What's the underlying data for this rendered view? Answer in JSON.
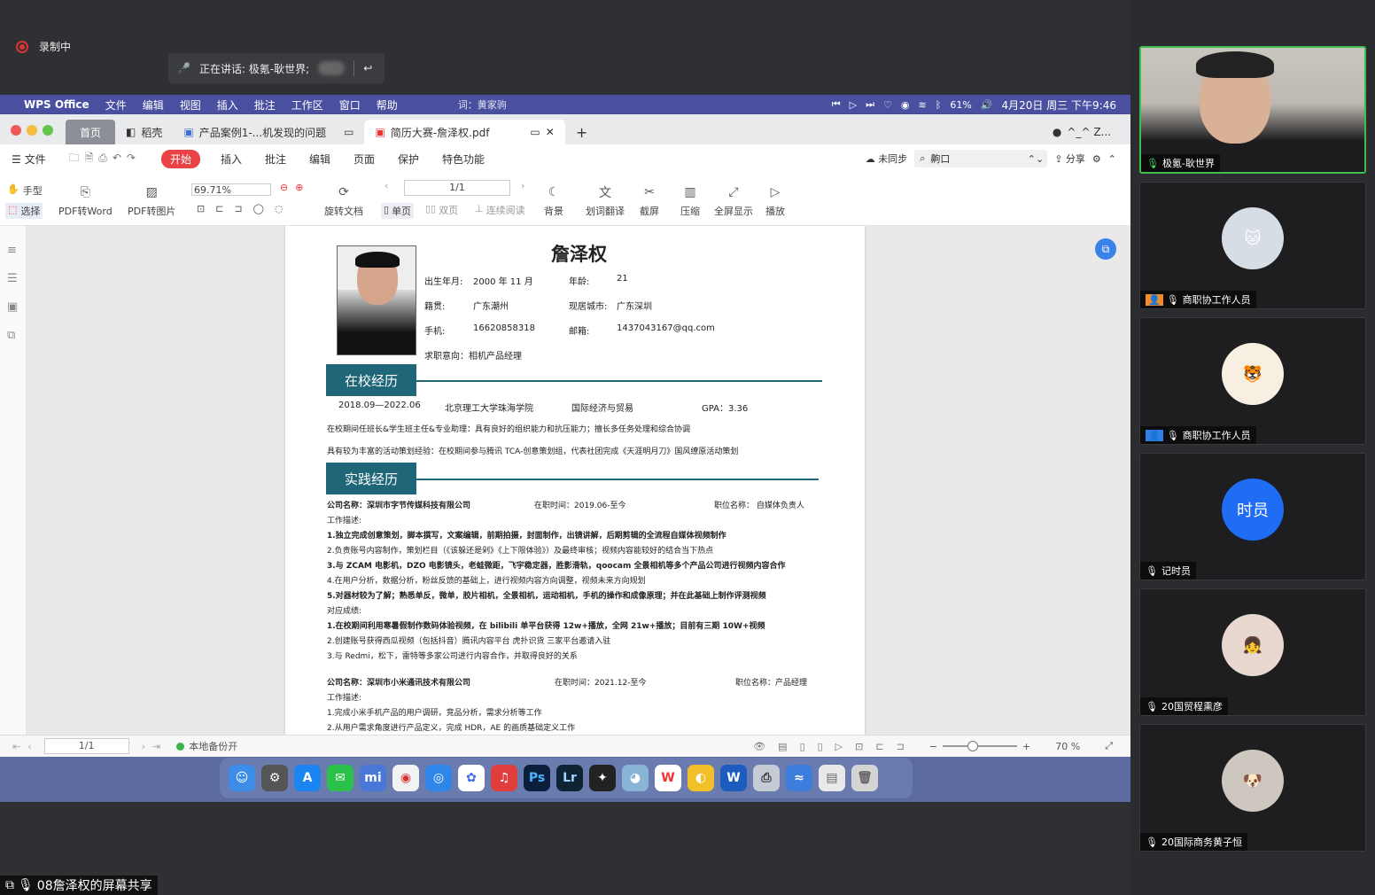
{
  "recording": {
    "label": "录制中"
  },
  "speaking": {
    "label": "正在讲话: 极氪-耿世界;"
  },
  "menubar": {
    "items": [
      "WPS Office",
      "文件",
      "编辑",
      "视图",
      "插入",
      "批注",
      "工作区",
      "窗口",
      "帮助"
    ],
    "input_hint": "词：黄家驹",
    "battery": "61%",
    "datetime": "4月20日 周三 下午9:46"
  },
  "tabs": {
    "home": "首页",
    "t1": "稻壳",
    "t2": "产品案例1-...机发现的问题",
    "t3": "简历大赛-詹泽权.pdf",
    "user": "^_^ Z..."
  },
  "menu2": {
    "file": "文件",
    "start": "开始",
    "items": [
      "插入",
      "批注",
      "编辑",
      "页面",
      "保护",
      "特色功能"
    ],
    "sync": "未同步",
    "search": "齁口",
    "share": "分享"
  },
  "toolbar": {
    "hand": "手型",
    "select": "选择",
    "pdf2word": "PDF转Word",
    "pdf2img": "PDF转图片",
    "zoom": "69.71%",
    "rotate": "旋转文档",
    "single": "单页",
    "double": "双页",
    "continuous": "连续阅读",
    "page": "1/1",
    "bg": "背景",
    "translate": "划词翻译",
    "screenshot": "截屏",
    "compress": "压缩",
    "fullscreen": "全屏显示",
    "play": "播放"
  },
  "resume": {
    "name": "詹泽权",
    "birth_label": "出生年月:",
    "birth": "2000 年 11 月",
    "age_label": "年龄:",
    "age": "21",
    "origin_label": "籍贯:",
    "origin": "广东潮州",
    "city_label": "现居城市:",
    "city": "广东深圳",
    "phone_label": "手机:",
    "phone": "16620858318",
    "email_label": "邮箱:",
    "email": "1437043167@qq.com",
    "intent": "求职意向：相机产品经理",
    "sec1": "在校经历",
    "edu_date": "2018.09—2022.06",
    "edu_school": "北京理工大学珠海学院",
    "edu_major": "国际经济与贸易",
    "edu_gpa": "GPA：3.36",
    "edu_l1": "在校期间任班长&学生班主任&专业助理：具有良好的组织能力和抗压能力；擅长多任务处理和综合协调",
    "edu_l2": "具有较为丰富的活动策划经验：在校期间参与腾讯 TCA-创意策划组，代表社团完成《天涯明月刀》国风缭原活动策划",
    "sec2": "实践经历",
    "c1_name": "公司名称：深圳市字节传媒科技有限公司",
    "c1_time": "在职时间：2019.06-至今",
    "c1_title": "职位名称：  自媒体负责人",
    "desc_label": "工作描述:",
    "c1_l1": "1.独立完成创意策划，脚本撰写，文案编辑，前期拍摄，封面制作，出镜讲解，后期剪辑的全流程自媒体视频制作",
    "c1_l2": "2.负责账号内容制作，策划栏目（《该躲还是剁》《上下限体验》）及最终审核；视频内容能较好的结合当下热点",
    "c1_l3": "3.与 ZCAM 电影机，DZO 电影镜头，老蛙微距，飞宇稳定器，胜影滑轨，qoocam 全景相机等多个产品公司进行视频内容合作",
    "c1_l4": "4.在用户分析，数据分析，粉丝反馈的基础上，进行视频内容方向调整，视频未来方向规划",
    "c1_l5": "5.对器材较为了解；熟悉单反，微单，胶片相机，全景相机，运动相机，手机的操作和成像原理；并在此基础上制作评测视频",
    "result_label": "对应成绩:",
    "c1_r1": "1.在校期间利用寒暑假制作数码体验视频，在 bilibili 单平台获得 12w+播放，全网 21w+播放；目前有三期 10W+视频",
    "c1_r2": "2.创建账号获得西瓜视频（包括抖音）腾讯内容平台 虎扑识货 三家平台邀请入驻",
    "c1_r3": "3.与 Redmi，松下，雷特等多家公司进行内容合作，并取得良好的关系",
    "c2_name": "公司名称：深圳市小米通讯技术有限公司",
    "c2_time": "在职时间：2021.12-至今",
    "c2_title": "职位名称：产品经理",
    "c2_l1": "1.完成小米手机产品的用户调研，竞品分析，需求分析等工作",
    "c2_l2": "2.从用户需求角度进行产品定义，完成 HDR，AE 的画质基础定义工作"
  },
  "status": {
    "page": "1/1",
    "backup": "本地备份开",
    "zoom": "70 %"
  },
  "participants": [
    {
      "name": "极氪-耿世界"
    },
    {
      "name": "商职协工作人员"
    },
    {
      "name": "商职协工作人员"
    },
    {
      "name": "记时员",
      "avatar_text": "时员"
    },
    {
      "name": "20国贸程熏彦"
    },
    {
      "name": "20国际商务黄子恒"
    }
  ],
  "share_label": "08詹泽权的屏幕共享"
}
